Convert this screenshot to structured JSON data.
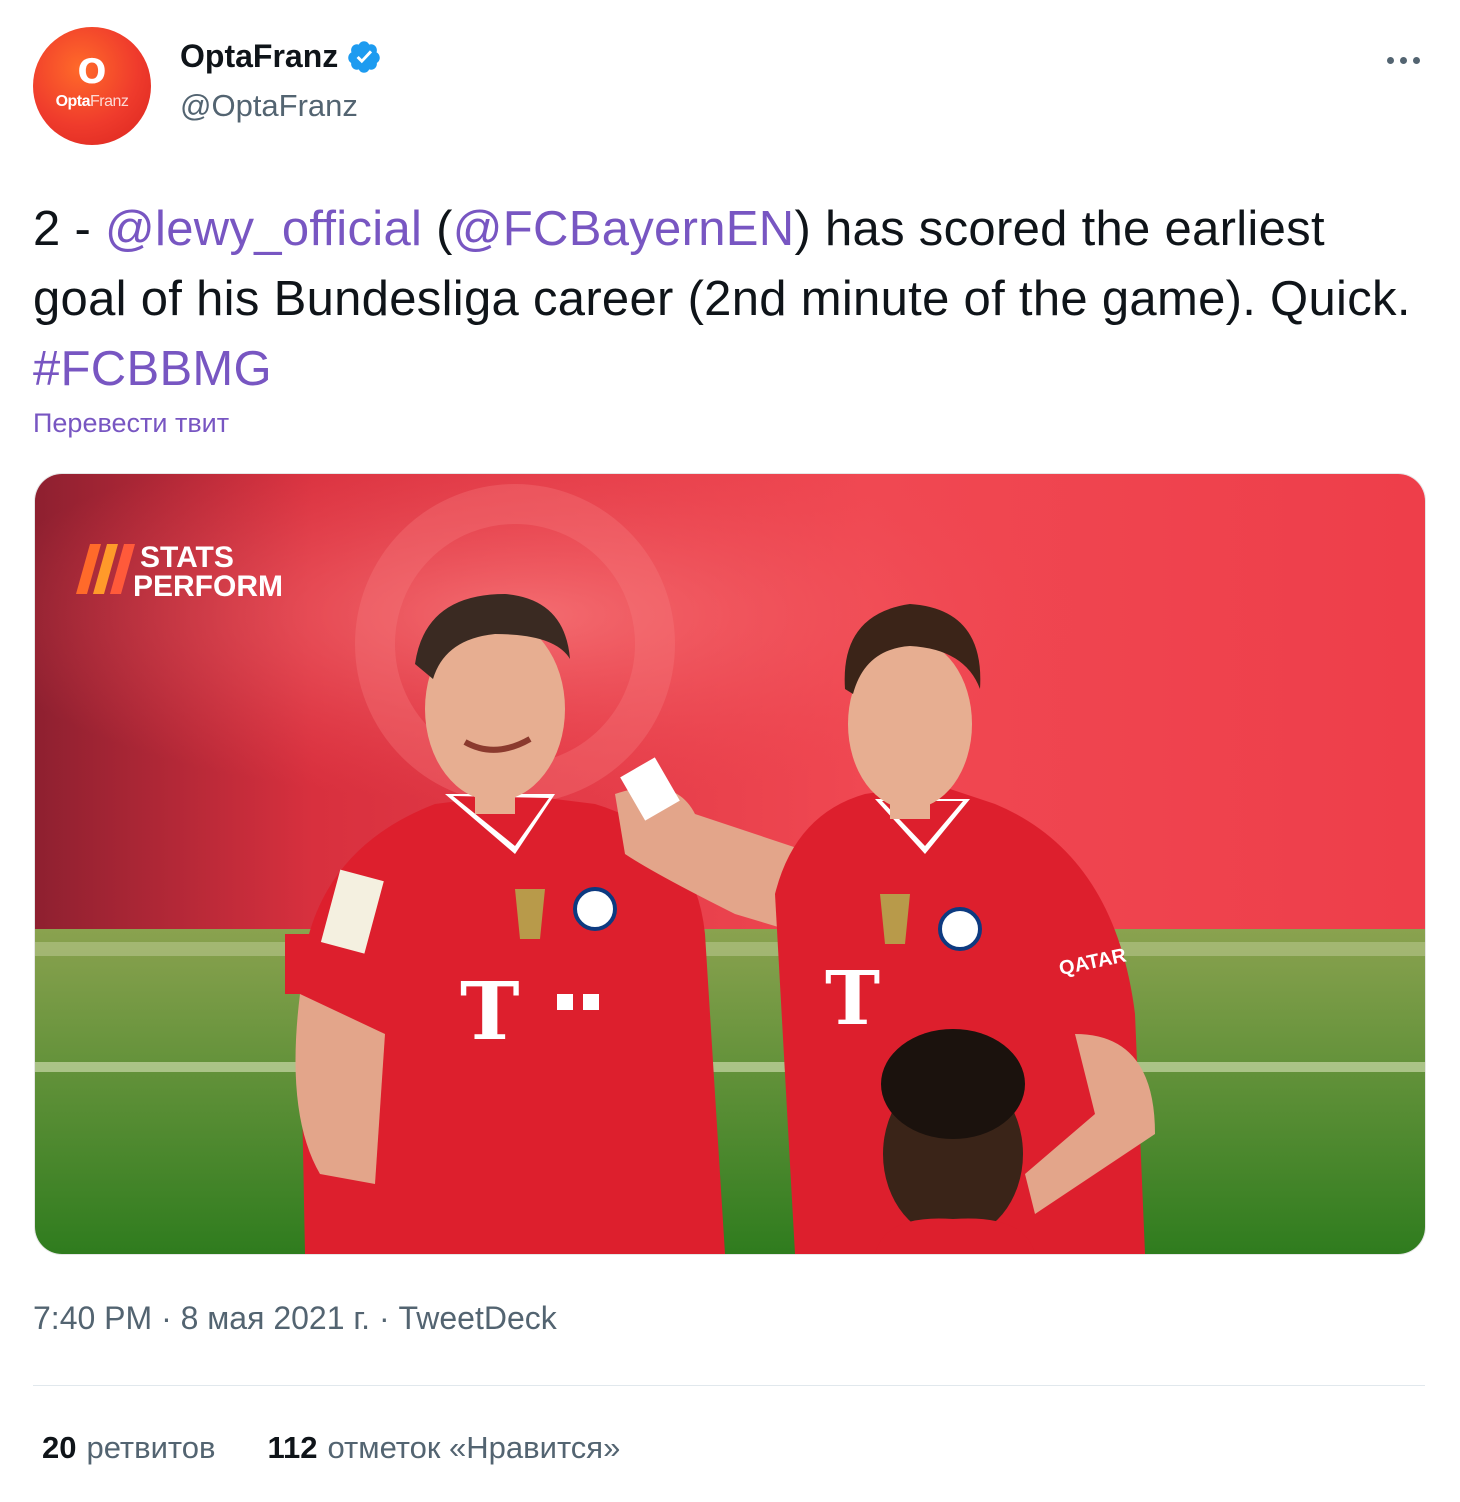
{
  "tweet": {
    "author": {
      "display_name": "OptaFranz",
      "handle": "@OptaFranz",
      "avatar_text": "Opta",
      "avatar_text_light": "Franz",
      "avatar_mark": "O",
      "verified": true
    },
    "text": {
      "prefix": "2 - ",
      "mention1": "@lewy_official",
      "paren_open": " (",
      "mention2": "@FCBayernEN",
      "mid": ") has scored the earliest goal of his Bundesliga career (2nd minute of the game). Quick. ",
      "hashtag": "#FCBBMG"
    },
    "translate_label": "Перевести твит",
    "media": {
      "watermark_line1": "STATS",
      "watermark_line2": "PERFORM",
      "shirt_sponsor": "T · · ·",
      "sleeve_sponsor": "QATAR"
    },
    "timestamp": "7:40 PM · 8 мая 2021 г. · TweetDeck",
    "stats": {
      "retweets_count": "20",
      "retweets_label": "ретвитов",
      "likes_count": "112",
      "likes_label": "отметок «Нравится»"
    }
  },
  "colors": {
    "link": "#7856c2",
    "text": "#0f1419",
    "secondary": "#536471",
    "verified": "#1d9bf0"
  }
}
